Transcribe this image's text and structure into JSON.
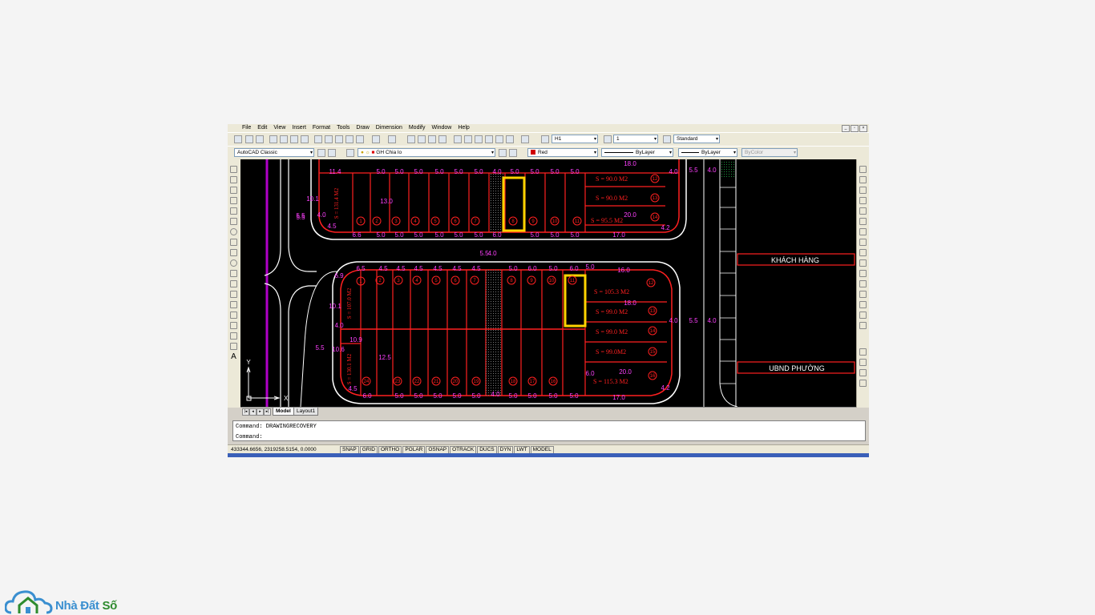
{
  "menu": [
    "File",
    "Edit",
    "View",
    "Insert",
    "Format",
    "Tools",
    "Draw",
    "Dimension",
    "Modify",
    "Window",
    "Help"
  ],
  "toolbar": {
    "text_style": "H1",
    "dim_style": "1",
    "table_style": "Standard",
    "workspace": "AutoCAD Classic",
    "layer": "GH Chia lo",
    "color": "Red",
    "linetype": "ByLayer",
    "lineweight": "ByLayer",
    "plotstyle": "ByColor"
  },
  "drawing": {
    "text_khach_hang": "KHÁCH HÀNG",
    "text_ubnd": "UBND PHƯỜNG",
    "block_top": {
      "top_dims": [
        "11.4",
        "5.0",
        "5.0",
        "5.0",
        "5.0",
        "5.0",
        "5.0",
        "4.0",
        "5.0",
        "5.0",
        "5.0",
        "5.0"
      ],
      "bottom_dims": [
        "6.6",
        "5.0",
        "5.0",
        "5.0",
        "5.0",
        "5.0",
        "5.0",
        "6.0",
        "5.0",
        "5.0",
        "5.0",
        "17.0"
      ],
      "lot_numbers": [
        "1",
        "2",
        "3",
        "4",
        "5",
        "6",
        "7",
        "8",
        "9",
        "10",
        "11"
      ],
      "right_lots": [
        {
          "num": "12",
          "area": "S = 90.0 M2",
          "dim": "18.0"
        },
        {
          "num": "13",
          "area": "S = 90.0 M2",
          "dim": ""
        },
        {
          "num": "14",
          "area": "S = 95.5 M2",
          "dim": "20.0"
        }
      ],
      "left_area": "S = 131.4 M2",
      "side_dims": [
        "10.1",
        "4.5",
        "4.0",
        "5.5",
        "13.0",
        "5.0",
        "4.0",
        "4.2",
        "5.5",
        "4.0"
      ]
    },
    "block_bottom": {
      "top_dims": [
        "6.5",
        "4.5",
        "4.5",
        "4.5",
        "4.5",
        "4.5",
        "4.5",
        "5.0",
        "6.0",
        "5.0",
        "6.0",
        "5.0",
        "6.0",
        "6.0",
        "16.0"
      ],
      "bottom_dims": [
        "6.0",
        "5.0",
        "5.0",
        "5.0",
        "5.0",
        "5.0",
        "4.0",
        "5.0",
        "5.0",
        "5.0",
        "5.0",
        "17.0"
      ],
      "lot_top_numbers": [
        "1",
        "2",
        "3",
        "4",
        "5",
        "6",
        "7",
        "8",
        "9",
        "10",
        "11"
      ],
      "lot_bottom_numbers": [
        "24",
        "23",
        "22",
        "21",
        "20",
        "19",
        "18",
        "17",
        "16"
      ],
      "right_lots": [
        {
          "num": "12",
          "area": "S = 105.3 M2",
          "dim": "18.0"
        },
        {
          "num": "13",
          "area": "S = 99.0 M2",
          "dim": ""
        },
        {
          "num": "14",
          "area": "S = 99.0 M2",
          "dim": ""
        },
        {
          "num": "15",
          "area": "S = 99.0M2",
          "dim": ""
        },
        {
          "num": "16",
          "area": "S = 115.3 M2",
          "dim": "20.0"
        }
      ],
      "left_area_top": "S = 107.0 M2",
      "left_area_bottom": "S = 130.1 M2",
      "side_dims": [
        "6.9",
        "10.1",
        "4.0",
        "5.5",
        "10.6",
        "4.5",
        "10.9",
        "12.5",
        "4.0",
        "5.5",
        "4.0",
        "4.5",
        "4.2",
        "6.0"
      ]
    },
    "mid_dims": [
      "5.5",
      "5.5",
      "4.0",
      "5.5"
    ],
    "road_dim_left": "5.5",
    "axis_y": "Y",
    "axis_x": "X"
  },
  "tabs": {
    "model": "Model",
    "layout": "Layout1"
  },
  "command": {
    "line1": "Command: DRAWINGRECOVERY",
    "line2": "Command:"
  },
  "status": {
    "coords": "433344.6656, 2319258.5154, 0.0000",
    "buttons": [
      "SNAP",
      "GRID",
      "ORTHO",
      "POLAR",
      "OSNAP",
      "OTRACK",
      "DUCS",
      "DYN",
      "LWT",
      "MODEL"
    ]
  },
  "logo": {
    "text_a": "Nhà Đất",
    "text_b": " Số",
    "color_a": "#3a8fd0",
    "color_b": "#2e8b2e"
  }
}
